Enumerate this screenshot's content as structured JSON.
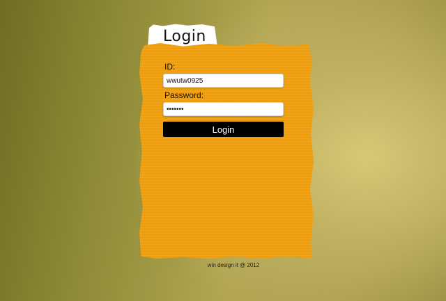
{
  "tab": {
    "title": "Login"
  },
  "form": {
    "id_label": "ID:",
    "id_value": "wwutw0925",
    "password_label": "Password:",
    "password_value": "wwutw09",
    "submit_label": "Login"
  },
  "footer": {
    "text": "win design it @ 2012"
  },
  "colors": {
    "panel": "#f5a30f",
    "background": "#b1a553",
    "button": "#000000"
  }
}
